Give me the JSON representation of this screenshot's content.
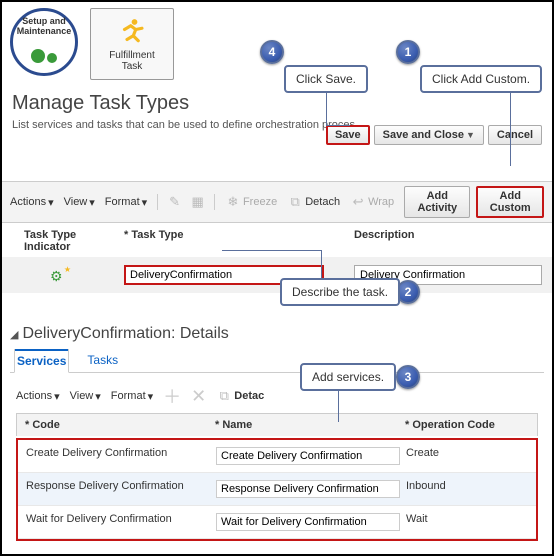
{
  "top_icons": {
    "setup_label": "Setup and\nMaintenance",
    "fulfillment_label": "Fulfillment\nTask"
  },
  "callouts": {
    "c1": {
      "num": "1",
      "text": "Click Add Custom."
    },
    "c2": {
      "num": "2",
      "text": "Describe the task."
    },
    "c3": {
      "num": "3",
      "text": "Add services."
    },
    "c4": {
      "num": "4",
      "text": "Click Save."
    }
  },
  "page": {
    "title": "Manage Task Types",
    "subtitle": "List services and tasks that can be used to define orchestration proces"
  },
  "top_buttons": {
    "save": "Save",
    "save_close": "Save and Close",
    "cancel": "Cancel"
  },
  "toolbar": {
    "actions": "Actions",
    "view": "View",
    "format": "Format",
    "freeze": "Freeze",
    "detach": "Detach",
    "wrap": "Wrap",
    "add_activity": "Add Activity",
    "add_custom": "Add Custom"
  },
  "task_table": {
    "col_indicator": "Task Type Indicator",
    "col_type": "Task Type",
    "col_desc": "Description",
    "row": {
      "type_value": "DeliveryConfirmation",
      "desc_value": "Delivery Confirmation"
    }
  },
  "details": {
    "title": "DeliveryConfirmation: Details",
    "tab_services": "Services",
    "tab_tasks": "Tasks"
  },
  "svc_toolbar": {
    "actions": "Actions",
    "view": "View",
    "format": "Format",
    "detach": "Detac"
  },
  "svc_table": {
    "col_code": "Code",
    "col_name": "Name",
    "col_op": "Operation Code",
    "rows": [
      {
        "code": "Create Delivery Confirmation",
        "name": "Create Delivery Confirmation",
        "op": "Create"
      },
      {
        "code": "Response Delivery Confirmation",
        "name": "Response Delivery Confirmation",
        "op": "Inbound"
      },
      {
        "code": "Wait for Delivery Confirmation",
        "name": "Wait for Delivery Confirmation",
        "op": "Wait"
      }
    ]
  }
}
